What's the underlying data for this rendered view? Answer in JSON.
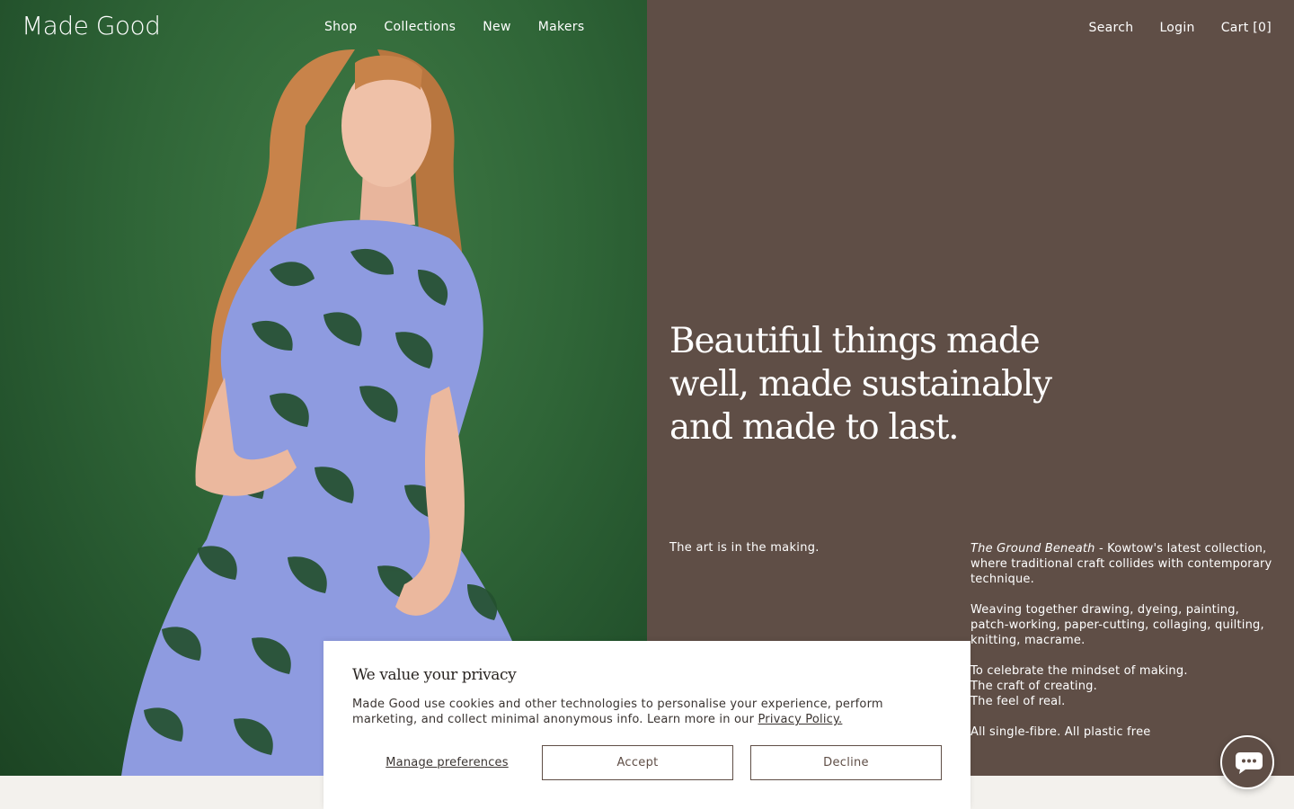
{
  "brand": {
    "logo_text": "Made Good"
  },
  "nav": {
    "main": [
      {
        "label": "Shop"
      },
      {
        "label": "Collections"
      },
      {
        "label": "New"
      },
      {
        "label": "Makers"
      }
    ],
    "search_label": "Search",
    "login_label": "Login",
    "cart_label": "Cart [0]"
  },
  "hero": {
    "image_icon": "model-in-floral-dress-photo",
    "headline": "Beautiful things made well, made sustainably and made to last.",
    "tagline": "The art is in the making.",
    "collection_name": "The Ground Beneath",
    "collection_intro": " - Kowtow's latest collection, where traditional craft collides with contemporary technique.",
    "paragraphs": [
      "Weaving together drawing, dyeing, painting, patch-working, paper-cutting, collaging, quilting, knitting, macrame.",
      "To celebrate the mindset of making.\nThe craft of creating.\nThe feel of real.",
      "All single-fibre. All plastic free"
    ]
  },
  "cookie": {
    "title": "We value your privacy",
    "text": "Made Good use cookies and other technologies to personalise your experience, perform marketing, and collect minimal anonymous info. Learn more in our ",
    "policy_link": "Privacy Policy.",
    "manage_label": "Manage preferences",
    "accept_label": "Accept",
    "decline_label": "Decline"
  },
  "chat": {
    "icon": "chat-bubble-icon"
  },
  "colors": {
    "panel": "#5f4e46",
    "hero_green": "#2f6537",
    "text_light": "#ffffff",
    "page_bg": "#f3f1ed"
  }
}
